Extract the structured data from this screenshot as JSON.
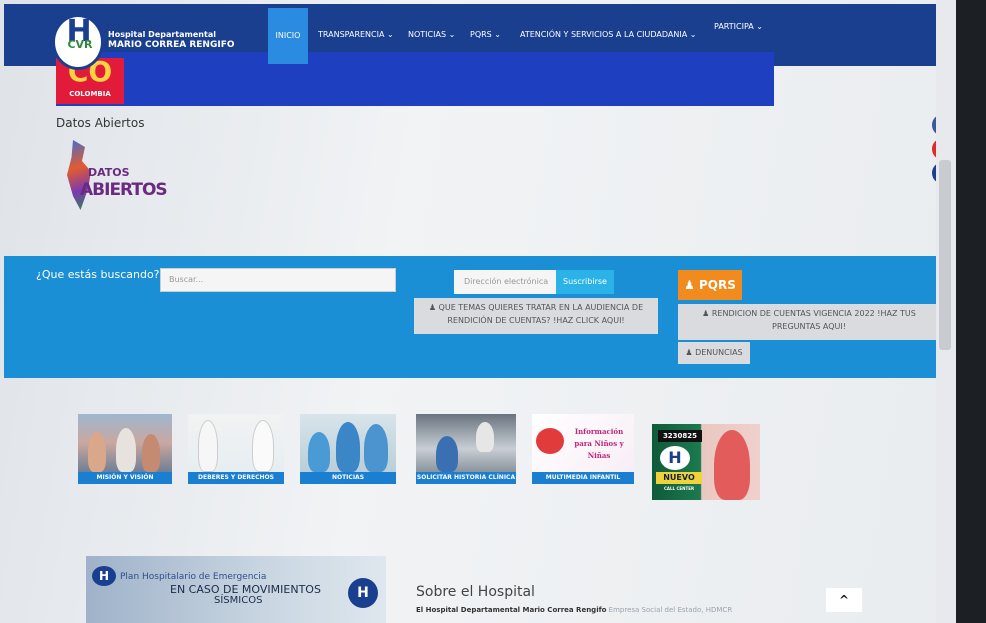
{
  "header": {
    "hospital_line1": "Hospital Departamental",
    "hospital_line2": "MARIO CORREA RENGIFO",
    "logo_letter": "H",
    "logo_sub": "CVR",
    "nav": [
      {
        "label": "INICIO"
      },
      {
        "label": "TRANSPARENCIA ⌄"
      },
      {
        "label": "NOTICIAS ⌄"
      },
      {
        "label": "PQRS ⌄"
      },
      {
        "label": "ATENCIÓN Y SERVICIOS A LA CIUDADANIA ⌄"
      },
      {
        "label": "PARTICIPA ⌄"
      }
    ]
  },
  "banner": {
    "co_text": "CO",
    "country": "COLOMBIA"
  },
  "datos": {
    "title": "Datos Abiertos",
    "logo_line1": "DATOS",
    "logo_line2": "ABIERTOS"
  },
  "social": [
    {
      "icon": "facebook-icon",
      "glyph": "f",
      "color": "#3b5998"
    },
    {
      "icon": "youtube-icon",
      "glyph": "▶",
      "color": "#e02a2a"
    },
    {
      "icon": "user-icon",
      "glyph": "●",
      "color": "#1b3f8f"
    }
  ],
  "search": {
    "label": "¿Que estás buscando?",
    "placeholder": "Buscar..."
  },
  "newsletter": {
    "placeholder": "Dirección electrónica",
    "button": "Suscribirse"
  },
  "pqrs_button": "PQRS",
  "audiencia_link": "QUE TEMAS QUIERES TRATAR EN LA AUDIENCIA DE RENDICIÓN DE CUENTAS? !HAZ CLICK AQUI!",
  "rendicion_link": "RENDICION DE CUENTAS VIGENCIA 2022 !HAZ TUS PREGUNTAS AQUI!",
  "denuncias_link": "DENUNCIAS",
  "tiles": [
    {
      "label": "MISIÓN Y VISIÓN"
    },
    {
      "label": "DEBERES Y DERECHOS"
    },
    {
      "label": "NOTICIAS"
    },
    {
      "label": "SOLICITAR HISTORIA CLÍNICA"
    },
    {
      "label": "MULTIMEDIA INFANTIL",
      "art_text": "Información para Niños y Niñas"
    },
    {
      "label": "",
      "phone": "3230825",
      "badge1": "NUEVO",
      "badge2": "CALL CENTER"
    }
  ],
  "plan": {
    "title": "Plan Hospitalario de Emergencia",
    "sub1": "EN CASO DE MOVIMIENTOS",
    "sub2": "SÍSMICOS"
  },
  "sobre": {
    "title": "Sobre el Hospital",
    "text_bold": "El Hospital Departamental Mario Correa Rengifo",
    "text_muted": " Empresa Social del Estado, HDMCR"
  },
  "back_to_top": "^",
  "colors": {
    "navbar": "#1b3f8f",
    "search_band": "#1a8fd6",
    "pqrs": "#f28b1e"
  }
}
